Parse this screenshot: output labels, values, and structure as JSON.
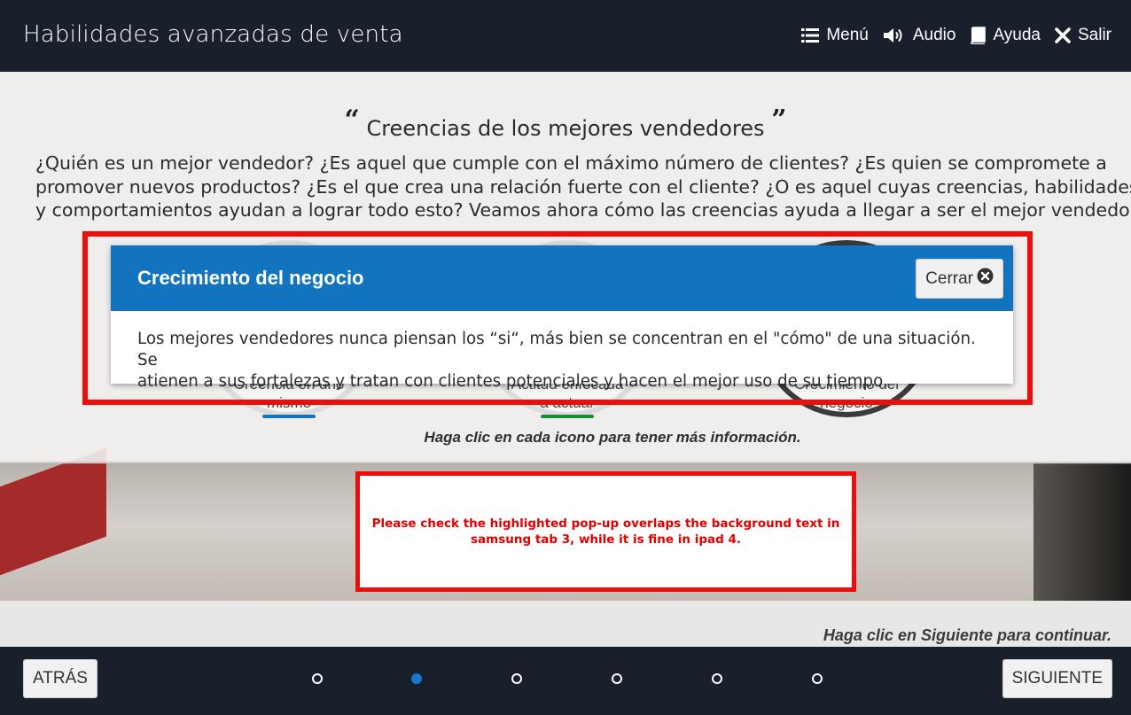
{
  "header": {
    "title": "Habilidades avanzadas de venta",
    "nav": [
      {
        "label": "Menú",
        "icon": "list-icon"
      },
      {
        "label": "Audio",
        "icon": "speaker-icon"
      },
      {
        "label": "Ayuda",
        "icon": "book-icon"
      },
      {
        "label": "Salir",
        "icon": "close-icon"
      }
    ]
  },
  "content": {
    "quote_title": "Creencias de los mejores vendedores",
    "quote_open": "“",
    "quote_close": "”",
    "intro_lines": [
      "¿Quién es un mejor vendedor? ¿Es aquel que cumple con el máximo número de clientes? ¿Es quien se compromete a",
      "promover nuevos productos? ¿Es el que crea una relación fuerte con el cliente? ¿O es aquel cuyas creencias, habilidades",
      "y comportamientos ayudan a lograr todo esto? Veamos ahora cómo las creencias ayuda a llegar a ser el mejor vendedor."
    ],
    "circles": [
      {
        "line1": "Creencia en uno",
        "line2": "mismo",
        "accent": "#1273bf"
      },
      {
        "line1": "Actitud enfocada",
        "line2": "a actuar",
        "accent": "#1d8a3a"
      },
      {
        "line1": "Crecimiento del",
        "line2": "negocio",
        "accent": "#444444"
      }
    ],
    "hint": "Haga clic en cada icono para tener más información.",
    "next_hint": "Haga clic en Siguiente para continuar."
  },
  "modal": {
    "title": "Crecimiento del negocio",
    "close_label": "Cerrar",
    "body_lines": [
      "Los mejores vendedores nunca piensan los “si“, más bien se concentran en el \"cómo\" de una situación. Se",
      "atienen a sus fortalezas y tratan con clientes potenciales y hacen el mejor uso de su tiempo."
    ]
  },
  "annotation": {
    "lines": [
      "Please check the highlighted pop-up overlaps the background text in",
      "samsung tab 3, while it is fine in ipad 4."
    ],
    "color": "#ee0d0d"
  },
  "footer": {
    "back_label": "ATRÁS",
    "next_label": "SIGUIENTE",
    "page_count": 6,
    "current_page": 2
  },
  "colors": {
    "bar_bg": "#19202b",
    "modal_header": "#1273bf",
    "active_dot": "#1678d3"
  }
}
